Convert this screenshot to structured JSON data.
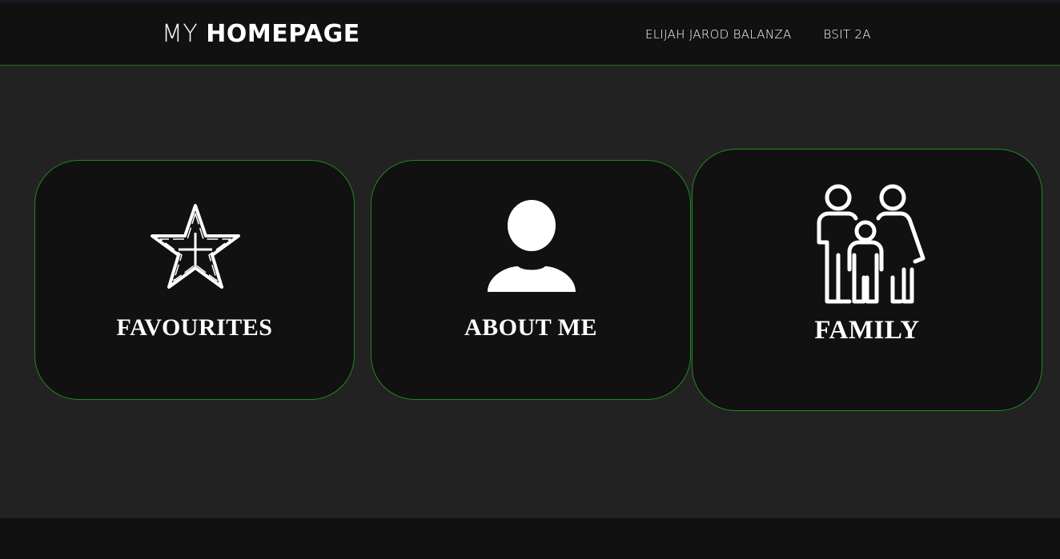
{
  "header": {
    "brand_light": "MY",
    "brand_bold": "HOMEPAGE",
    "nav": [
      {
        "label": "ELIJAH JAROD BALANZA"
      },
      {
        "label": "BSIT 2A"
      }
    ]
  },
  "cards": [
    {
      "label": "FAVOURITES",
      "icon": "star-plus-icon"
    },
    {
      "label": "ABOUT ME",
      "icon": "user-icon"
    },
    {
      "label": "FAMILY",
      "icon": "family-icon"
    }
  ],
  "colors": {
    "background": "#222222",
    "header_bg": "#111111",
    "card_bg": "#111111",
    "accent_border": "#1f8a1f",
    "text": "#ffffff"
  }
}
